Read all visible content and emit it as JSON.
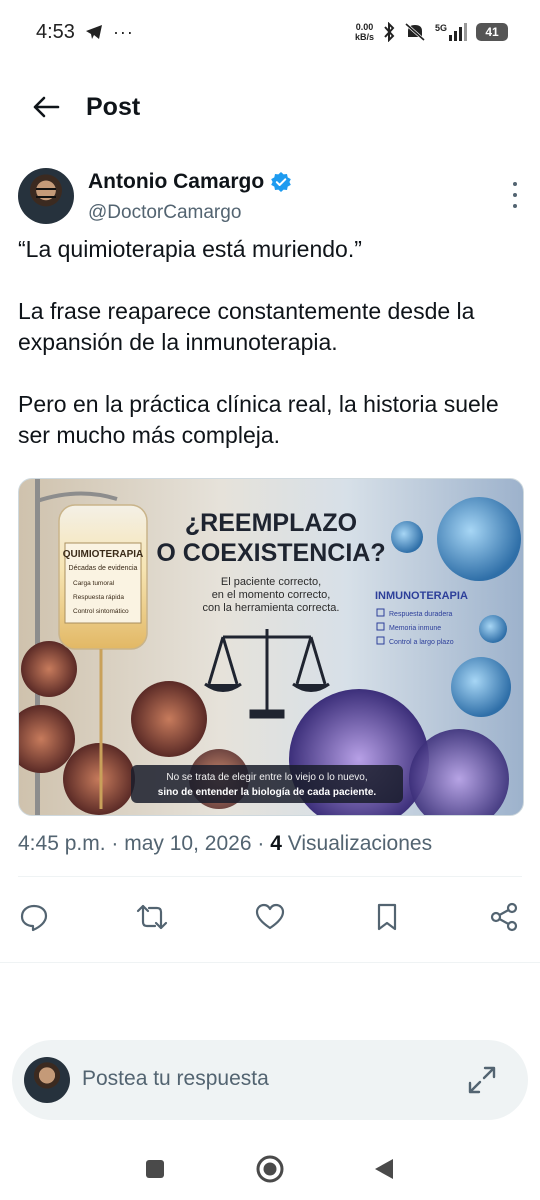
{
  "status": {
    "time": "4:53",
    "net_speed_top": "0.00",
    "net_speed_bottom": "kB/s",
    "net_type": "5G",
    "battery": "41"
  },
  "header": {
    "title": "Post"
  },
  "author": {
    "name": "Antonio Camargo",
    "handle": "@DoctorCamargo"
  },
  "post": {
    "p1": "“La quimioterapia está muriendo.”",
    "p2": "La frase reaparece constantemente desde la expansión de la inmunoterapia.",
    "p3": "Pero en la práctica clínica real, la historia suele ser mucho más compleja."
  },
  "image": {
    "title_line1": "¿REEMPLAZO",
    "title_line2": "O COEXISTENCIA?",
    "subtitle_line1": "El paciente correcto,",
    "subtitle_line2": "en el momento correcto,",
    "subtitle_line3": "con la herramienta correcta.",
    "left_label": "QUIMIOTERAPIA",
    "left_sub": "Décadas de evidencia",
    "left_items": [
      "Carga tumoral",
      "Respuesta rápida",
      "Control sintomático"
    ],
    "right_label": "INMUNOTERAPIA",
    "right_items": [
      "Respuesta duradera",
      "Memoria inmune",
      "Control a largo plazo"
    ],
    "caption_line1": "No se trata de elegir entre lo viejo o lo nuevo,",
    "caption_line2": "sino de entender la biología de cada paciente."
  },
  "meta": {
    "time": "4:45 p.m.",
    "sep1": "·",
    "date": "may 10, 2026",
    "sep2": "·",
    "views_count": "4",
    "views_label": "Visualizaciones"
  },
  "reply": {
    "placeholder": "Postea tu respuesta"
  },
  "colors": {
    "accent": "#1d9bf0",
    "text": "#0f1419",
    "muted": "#536471"
  }
}
